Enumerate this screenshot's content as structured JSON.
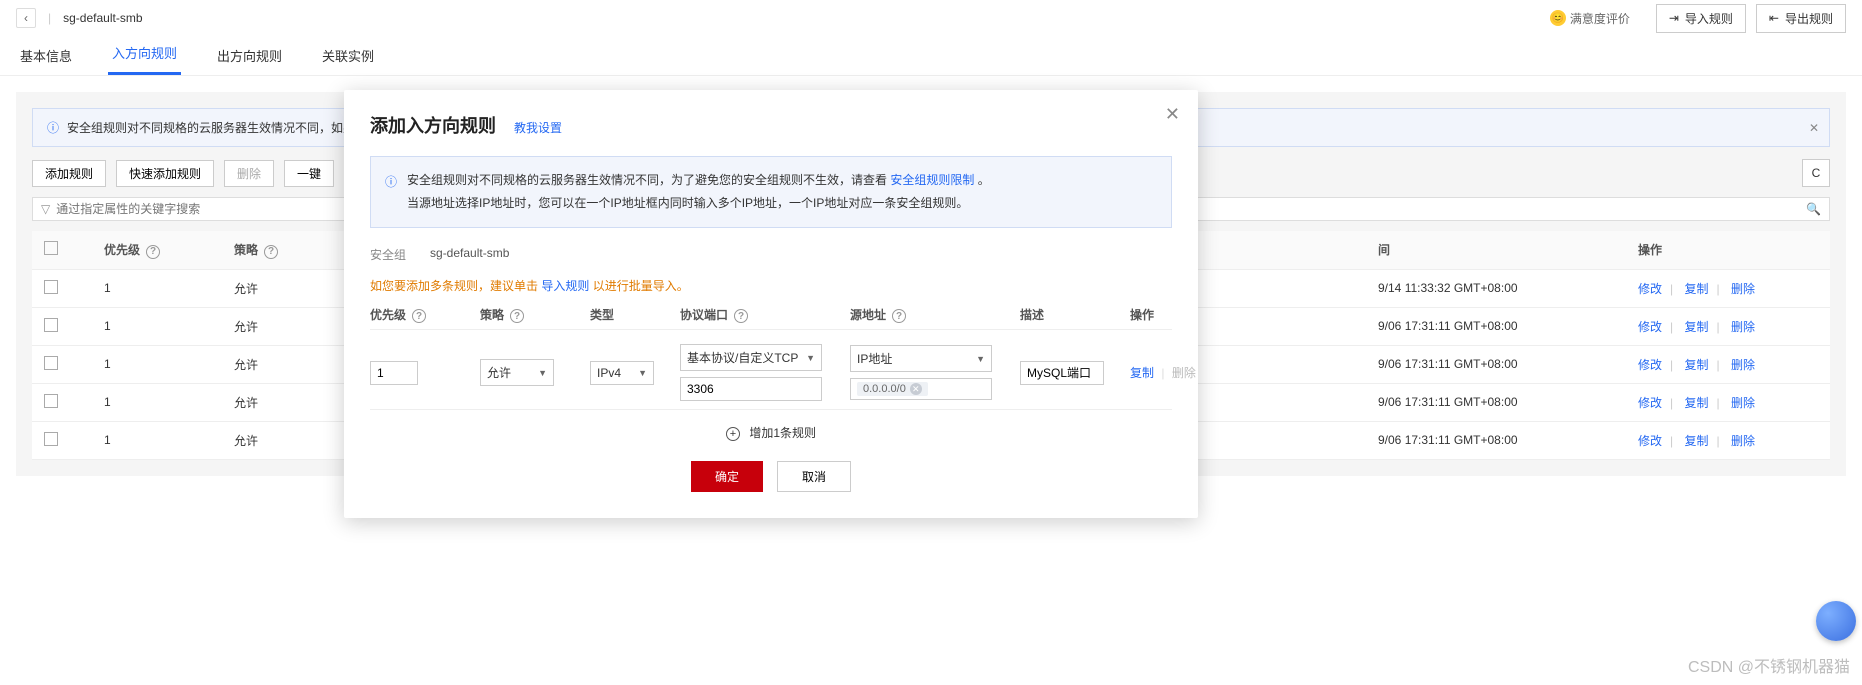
{
  "topbar": {
    "title": "sg-default-smb",
    "rating_label": "满意度评价",
    "import_btn": "导入规则",
    "export_btn": "导出规则"
  },
  "tabs": {
    "basic": "基本信息",
    "inbound": "入方向规则",
    "outbound": "出方向规则",
    "associate": "关联实例"
  },
  "bg_alert": "安全组规则对不同规格的云服务器生效情况不同，如果您",
  "toolbar": {
    "add": "添加规则",
    "quick_add": "快速添加规则",
    "delete": "删除",
    "oneclick": "一键"
  },
  "search_placeholder": "通过指定属性的关键字搜索",
  "table": {
    "headers": {
      "priority": "优先级",
      "strategy": "策略",
      "time_suffix": "间",
      "ops": "操作"
    },
    "row_ops": {
      "modify": "修改",
      "copy": "复制",
      "delete": "删除"
    },
    "rows": [
      {
        "priority": "1",
        "strategy": "允许",
        "time": "9/14 11:33:32 GMT+08:00"
      },
      {
        "priority": "1",
        "strategy": "允许",
        "time": "9/06 17:31:11 GMT+08:00"
      },
      {
        "priority": "1",
        "strategy": "允许",
        "time": "9/06 17:31:11 GMT+08:00"
      },
      {
        "priority": "1",
        "strategy": "允许",
        "time": "9/06 17:31:11 GMT+08:00"
      },
      {
        "priority": "1",
        "strategy": "允许",
        "time": "9/06 17:31:11 GMT+08:00"
      }
    ]
  },
  "modal": {
    "title": "添加入方向规则",
    "help_link": "教我设置",
    "alert_line1_a": "安全组规则对不同规格的云服务器生效情况不同，为了避免您的安全组规则不生效，请查看",
    "alert_line1_link": "安全组规则限制",
    "alert_line1_b": "。",
    "alert_line2": "当源地址选择IP地址时，您可以在一个IP地址框内同时输入多个IP地址，一个IP地址对应一条安全组规则。",
    "sg_label": "安全组",
    "sg_value": "sg-default-smb",
    "tip_orange_a": "如您要添加多条规则，建议单击 ",
    "tip_orange_link": "导入规则",
    "tip_orange_b": " 以进行批量导入。",
    "form_head": {
      "priority": "优先级",
      "strategy": "策略",
      "type": "类型",
      "proto_port": "协议端口",
      "source": "源地址",
      "desc": "描述",
      "ops": "操作"
    },
    "form_values": {
      "priority": "1",
      "strategy": "允许",
      "type": "IPv4",
      "proto": "基本协议/自定义TCP",
      "port": "3306",
      "source_mode": "IP地址",
      "source_ip_chip": "0.0.0.0/0",
      "desc": "MySQL端口"
    },
    "row_ops": {
      "copy": "复制",
      "delete": "删除"
    },
    "add_more": "增加1条规则",
    "ok": "确定",
    "cancel": "取消"
  },
  "watermark": "CSDN @不锈钢机器猫"
}
